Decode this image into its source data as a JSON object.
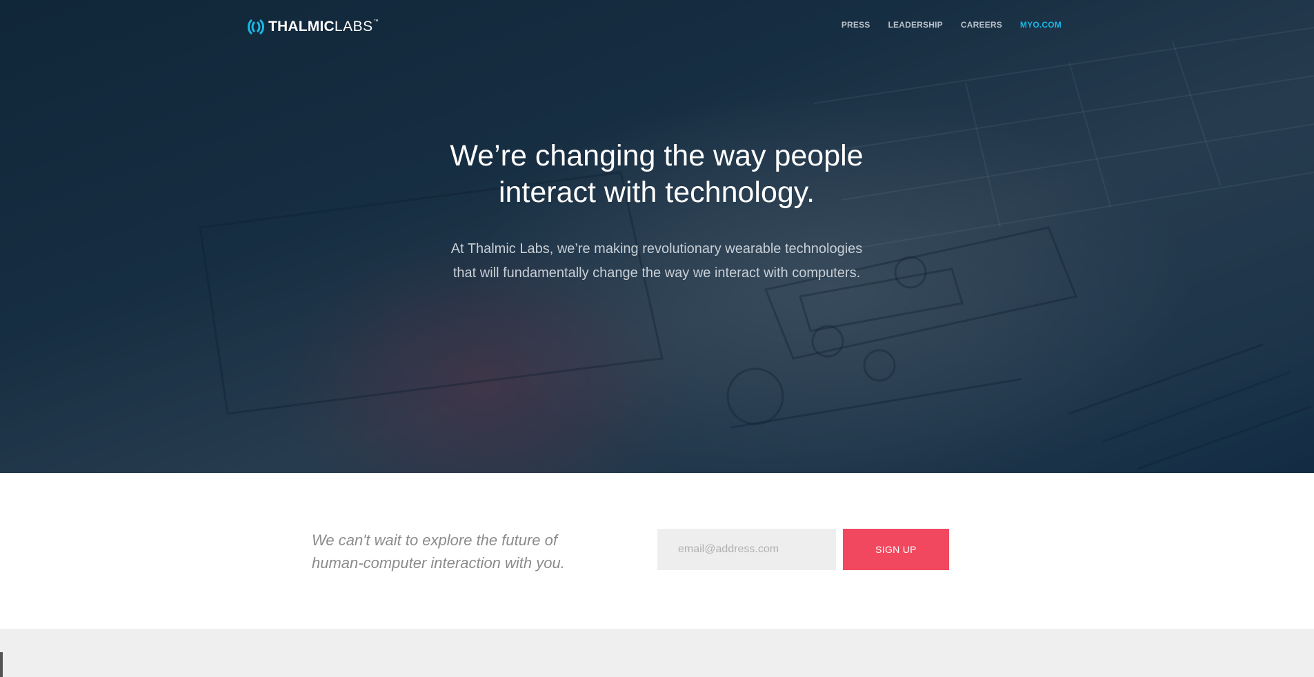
{
  "brand": {
    "name_bold": "THALMIC",
    "name_light": "LABS",
    "trademark": "™",
    "icon": "thalmic-logo-mark",
    "accent_color": "#19b8e6"
  },
  "nav": {
    "items": [
      {
        "label": "PRESS"
      },
      {
        "label": "LEADERSHIP"
      },
      {
        "label": "CAREERS"
      },
      {
        "label": "MYO.COM",
        "accent": true
      }
    ]
  },
  "hero": {
    "headline_line1": "We’re changing the way people",
    "headline_line2": "interact with technology.",
    "subtext": "At Thalmic Labs, we’re making revolutionary wearable technologies that will fundamentally change the way we interact with computers."
  },
  "signup": {
    "tagline_line1": "We can't wait to explore the future of",
    "tagline_line2": "human-computer interaction with you.",
    "email_placeholder": "email@address.com",
    "email_value": "",
    "button_label": "SIGN UP",
    "button_color": "#f2485f"
  }
}
